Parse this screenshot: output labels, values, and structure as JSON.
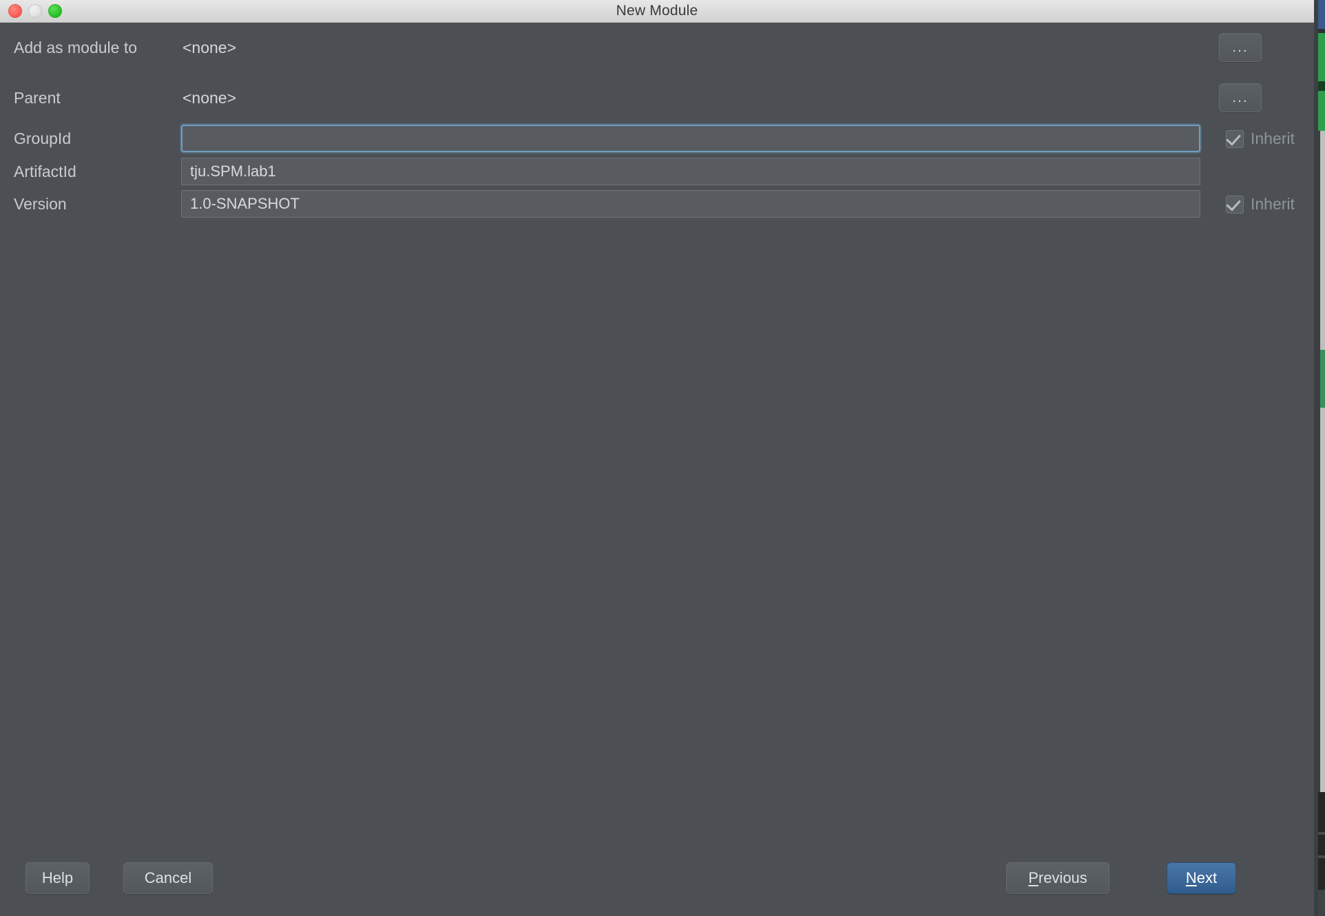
{
  "window": {
    "title": "New Module",
    "traffic_lights": [
      "close-button",
      "minimize-button",
      "maximize-button"
    ]
  },
  "form": {
    "rows": [
      {
        "label": "Add as module to",
        "type": "static",
        "value": "<none>",
        "browse_label": "...",
        "has_browse": true,
        "has_inherit": false
      },
      {
        "label": "Parent",
        "type": "static",
        "value": "<none>",
        "browse_label": "...",
        "has_browse": true,
        "has_inherit": false
      },
      {
        "label": "GroupId",
        "type": "input",
        "value": "",
        "placeholder": "",
        "focused": true,
        "has_browse": false,
        "has_inherit": true,
        "inherit_label": "Inherit",
        "inherit_checked": true
      },
      {
        "label": "ArtifactId",
        "type": "input",
        "value": "tju.SPM.lab1",
        "placeholder": "",
        "focused": false,
        "has_browse": false,
        "has_inherit": false
      },
      {
        "label": "Version",
        "type": "input",
        "value": "1.0-SNAPSHOT",
        "placeholder": "",
        "focused": false,
        "has_browse": false,
        "has_inherit": true,
        "inherit_label": "Inherit",
        "inherit_checked": true
      }
    ]
  },
  "buttons": {
    "help": "Help",
    "cancel": "Cancel",
    "previous": "Previous",
    "previous_mnemonic": "P",
    "previous_rest": "revious",
    "next": "Next",
    "next_mnemonic": "N",
    "next_rest": "ext"
  },
  "colors": {
    "dialog_background": "#4c5054",
    "titlebar_background": "#dcdcdc",
    "field_background": "#585c60",
    "focus_border": "#6d9fc6",
    "default_button": "#2f5c8d",
    "label_text": "#c8ccce",
    "disabled_text": "#8f9499"
  }
}
